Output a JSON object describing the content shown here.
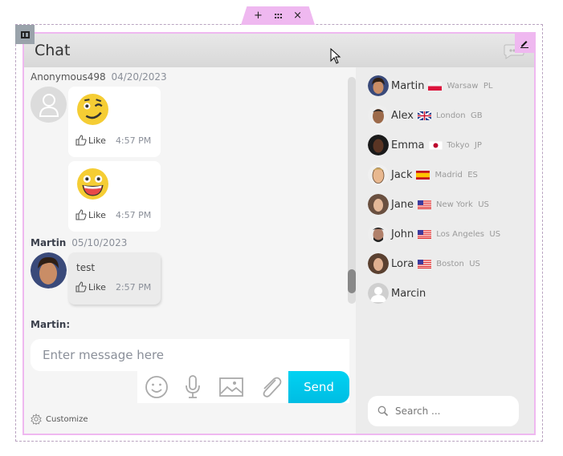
{
  "toolbar": {
    "add": "+",
    "move": "⠿",
    "close": "×"
  },
  "header": {
    "title": "Chat"
  },
  "messages": [
    {
      "author": "Anonymous498",
      "date": "04/20/2023",
      "bold": false,
      "items": [
        {
          "type": "emoji",
          "emoji": "winking-face",
          "like": "Like",
          "time": "4:57 PM"
        },
        {
          "type": "emoji",
          "emoji": "grinning-face",
          "like": "Like",
          "time": "4:57 PM"
        }
      ]
    },
    {
      "author": "Martin",
      "date": "05/10/2023",
      "bold": true,
      "items": [
        {
          "type": "text",
          "text": "test",
          "like": "Like",
          "time": "2:57 PM"
        }
      ]
    }
  ],
  "scroll": {
    "position": 0.95
  },
  "composer": {
    "label": "Martin:",
    "placeholder": "Enter message here",
    "value": "",
    "send_label": "Send",
    "tools": [
      "emoji-icon",
      "microphone-icon",
      "image-icon",
      "paperclip-icon"
    ]
  },
  "footer": {
    "customize": "Customize"
  },
  "users": [
    {
      "name": "Martin",
      "flag": "PL",
      "city": "Warsaw",
      "country": "PL"
    },
    {
      "name": "Alex",
      "flag": "GB",
      "city": "London",
      "country": "GB"
    },
    {
      "name": "Emma",
      "flag": "JP",
      "city": "Tokyo",
      "country": "JP"
    },
    {
      "name": "Jack",
      "flag": "ES",
      "city": "Madrid",
      "country": "ES"
    },
    {
      "name": "Jane",
      "flag": "US",
      "city": "New York",
      "country": "US"
    },
    {
      "name": "John",
      "flag": "US",
      "city": "Los Angeles",
      "country": "US"
    },
    {
      "name": "Lora",
      "flag": "US",
      "city": "Boston",
      "country": "US"
    },
    {
      "name": "Marcin",
      "flag": "",
      "city": "",
      "country": ""
    }
  ],
  "search": {
    "placeholder": "Search ...",
    "value": ""
  },
  "colors": {
    "accent": "#00c8ec",
    "selection": "#efb8f0",
    "header": "#dddddd"
  }
}
